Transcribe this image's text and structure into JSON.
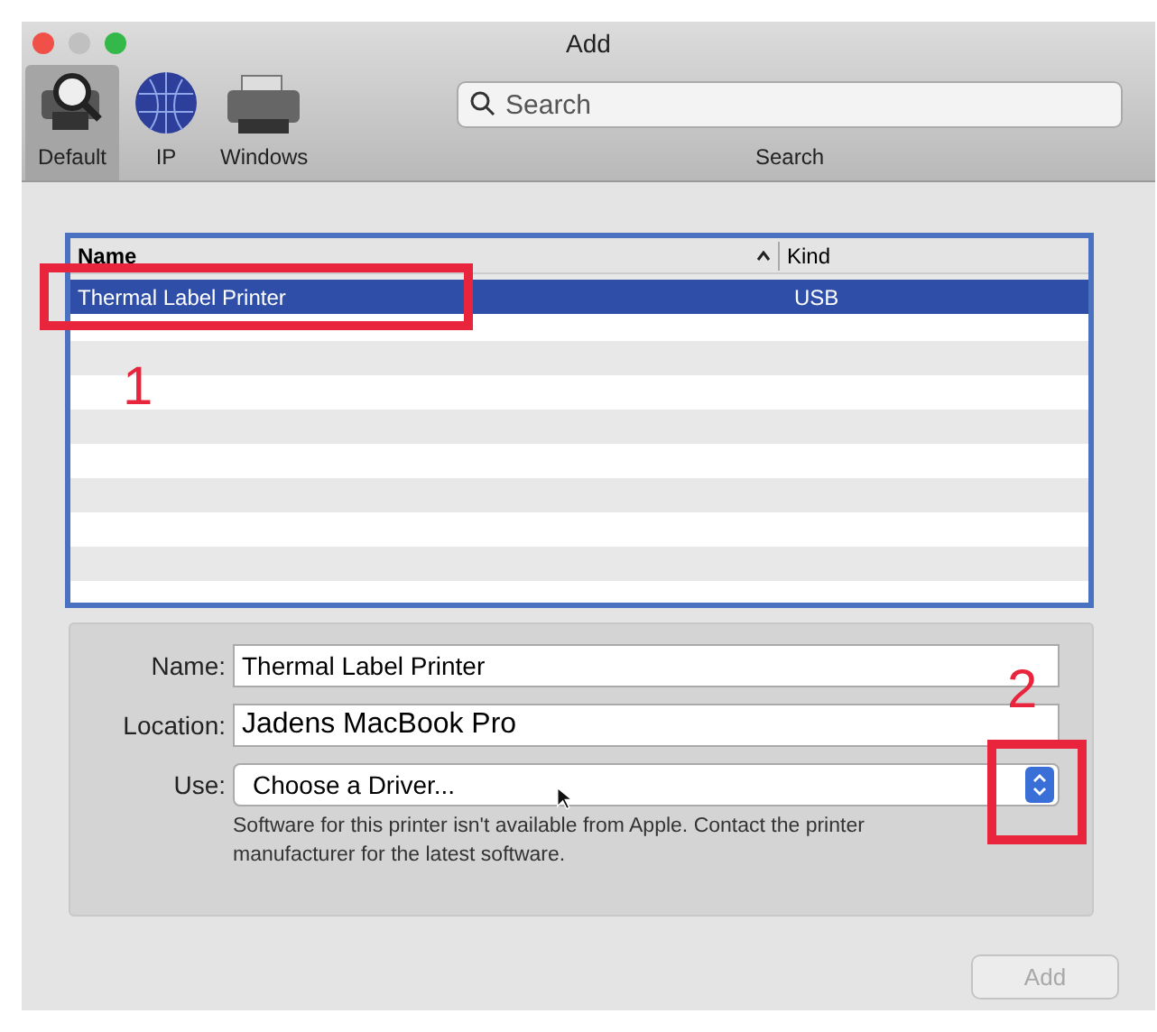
{
  "window": {
    "title": "Add"
  },
  "toolbar": {
    "items": [
      {
        "label": "Default",
        "kind": "default",
        "selected": true
      },
      {
        "label": "IP",
        "kind": "ip",
        "selected": false
      },
      {
        "label": "Windows",
        "kind": "windows",
        "selected": false
      }
    ],
    "search": {
      "placeholder": "Search",
      "label": "Search"
    }
  },
  "table": {
    "columns": [
      {
        "label": "Name",
        "sorted": true
      },
      {
        "label": "Kind",
        "sorted": false
      }
    ],
    "rows": [
      {
        "name": "Thermal Label Printer",
        "kind": "USB",
        "selected": true
      }
    ]
  },
  "form": {
    "name_label": "Name:",
    "name_value": "Thermal Label Printer",
    "location_label": "Location:",
    "location_value": "Jadens MacBook Pro",
    "use_label": "Use:",
    "use_value": "Choose a Driver...",
    "note": "Software for this printer isn't available from Apple. Contact the printer manufacturer for the latest software."
  },
  "add_button": {
    "label": "Add",
    "disabled": true
  },
  "annotations": [
    {
      "label": "1"
    },
    {
      "label": "2"
    }
  ]
}
